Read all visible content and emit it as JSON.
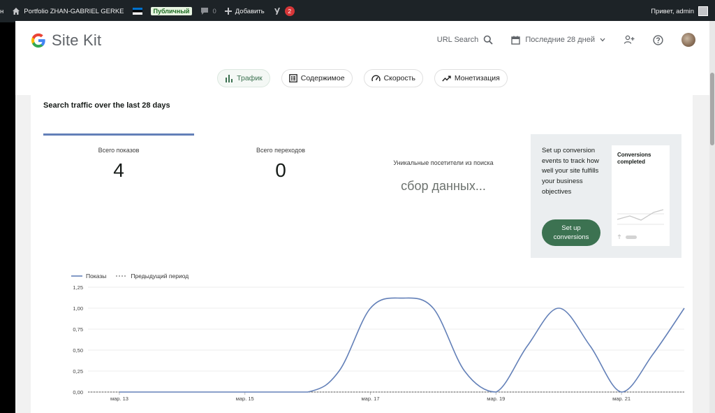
{
  "adminbar": {
    "edge_text": "н",
    "site_name": "Portfolio ZHAN-GABRIEL GERKE",
    "public_badge": "Публичный",
    "comments_count": "0",
    "add_label": "Добавить",
    "yoast_count": "2",
    "greeting": "Привет, admin"
  },
  "header": {
    "logo_text": "Site Kit",
    "url_search": "URL Search",
    "date_range": "Последние 28 дней"
  },
  "nav": {
    "tabs": [
      {
        "label": "Трафик",
        "icon": "bar-chart-icon",
        "active": true
      },
      {
        "label": "Содержимое",
        "icon": "content-icon",
        "active": false
      },
      {
        "label": "Скорость",
        "icon": "speed-icon",
        "active": false
      },
      {
        "label": "Монетизация",
        "icon": "trend-icon",
        "active": false
      }
    ]
  },
  "card": {
    "title": "Search traffic over the last 28 days",
    "metrics": [
      {
        "label": "Всего показов",
        "value": "4"
      },
      {
        "label": "Всего переходов",
        "value": "0"
      },
      {
        "label": "Уникальные посетители из поиска",
        "value": "сбор данных..."
      }
    ],
    "promo": {
      "text": "Set up conversion events to track how well your site fulfills your business objectives",
      "button_line1": "Set up",
      "button_line2": "conversions",
      "mini_title_line1": "Conversions",
      "mini_title_line2": "completed"
    }
  },
  "colors": {
    "accent_green": "#3c7251",
    "series_blue": "#6380b8",
    "admin_bar": "#1d2327"
  },
  "chart_data": {
    "type": "line",
    "series": [
      {
        "name": "Показы",
        "style": "solid",
        "x": [
          13,
          14,
          15,
          16,
          16.5,
          17,
          17.5,
          18,
          18.5,
          19,
          19.5,
          20,
          20.5,
          21,
          21.5,
          22
        ],
        "y": [
          0,
          0,
          0,
          0,
          0.25,
          1.0,
          1.12,
          1.0,
          0.25,
          0,
          0.55,
          1.0,
          0.55,
          0,
          0.45,
          1.0
        ]
      },
      {
        "name": "Предыдущий период",
        "style": "dashed",
        "x": [
          12.5,
          22
        ],
        "y": [
          0,
          0
        ]
      }
    ],
    "y_ticks": [
      "0,00",
      "0,25",
      "0,50",
      "0,75",
      "1,00",
      "1,25"
    ],
    "x_ticks": [
      {
        "x": 13,
        "label": "мар. 13"
      },
      {
        "x": 15,
        "label": "мар. 15"
      },
      {
        "x": 17,
        "label": "мар. 17"
      },
      {
        "x": 19,
        "label": "мар. 19"
      },
      {
        "x": 21,
        "label": "мар. 21"
      }
    ],
    "xlim": [
      12.5,
      22
    ],
    "ylim": [
      0,
      1.25
    ],
    "grid": true,
    "legend": "top-left"
  }
}
